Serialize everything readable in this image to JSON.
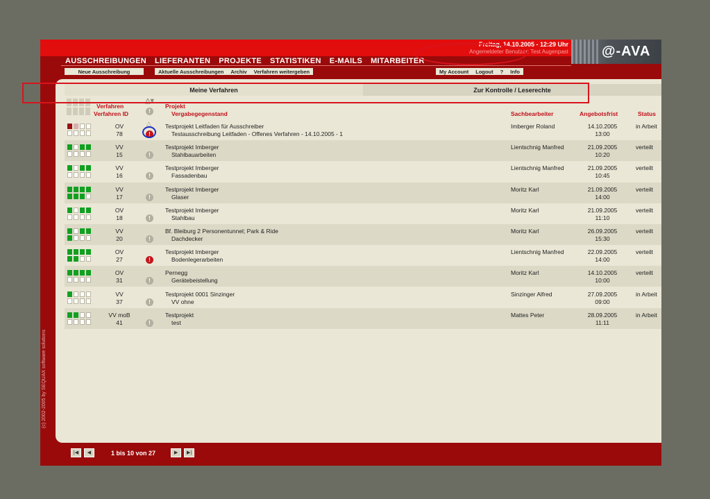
{
  "header": {
    "date": "Freitag, 14.10.2005 - 12:29 Uhr",
    "user": "Angemeldeter Benutzer:  Test Augenpast",
    "logo": "@-AVA"
  },
  "main_nav": [
    "AUSSCHREIBUNGEN",
    "LIEFERANTEN",
    "PROJEKTE",
    "STATISTIKEN",
    "E-MAILS",
    "MITARBEITER"
  ],
  "sub_nav_left": [
    "Neue Ausschreibung"
  ],
  "sub_nav_mid": [
    "Aktuelle Ausschreibungen",
    "Archiv",
    "Verfahren weitergeben"
  ],
  "sub_nav_right": [
    "My Account",
    "Logout",
    "?",
    "Info"
  ],
  "tabs": {
    "mine": "Meine Verfahren",
    "control": "Zur Kontrolle / Leserechte"
  },
  "columns": {
    "verfahren": "Verfahren",
    "verfahren_id": "Verfahren ID",
    "projekt": "Projekt",
    "vergabe": "Vergabegegenstand",
    "sachbearbeiter": "Sachbearbeiter",
    "angebotsfrist": "Angebotsfrist",
    "status": "Status"
  },
  "rows": [
    {
      "type": "OV",
      "id": "78",
      "project": "Testprojekt Leitfaden für Ausschreiber",
      "subject": "Testausschreibung Leitfaden - Offenes Verfahren - 14.10.2005 - 1",
      "person": "Imberger Roland",
      "date": "14.10.2005",
      "time": "13:00",
      "status": "in Arbeit",
      "squares": [
        "r",
        "p",
        "w",
        "w",
        "w",
        "w",
        "w",
        "w"
      ],
      "warn": "red"
    },
    {
      "type": "VV",
      "id": "15",
      "project": "Testprojekt Imberger",
      "subject": "Stahlbauarbeiten",
      "person": "Lientschnig Manfred",
      "date": "21.09.2005",
      "time": "10:20",
      "status": "verteilt",
      "squares": [
        "g",
        "w",
        "g",
        "g",
        "w",
        "w",
        "w",
        "w"
      ],
      "warn": "grey"
    },
    {
      "type": "VV",
      "id": "16",
      "project": "Testprojekt Imberger",
      "subject": "Fassadenbau",
      "person": "Lientschnig Manfred",
      "date": "21.09.2005",
      "time": "10:45",
      "status": "verteilt",
      "squares": [
        "g",
        "w",
        "g",
        "g",
        "w",
        "w",
        "w",
        "w"
      ],
      "warn": "grey"
    },
    {
      "type": "VV",
      "id": "17",
      "project": "Testprojekt Imberger",
      "subject": "Glaser",
      "person": "Moritz Karl",
      "date": "21.09.2005",
      "time": "14:00",
      "status": "verteilt",
      "squares": [
        "g",
        "g",
        "g",
        "g",
        "g",
        "g",
        "g",
        "w"
      ],
      "warn": "grey"
    },
    {
      "type": "OV",
      "id": "18",
      "project": "Testprojekt Imberger",
      "subject": "Stahlbau",
      "person": "Moritz Karl",
      "date": "21.09.2005",
      "time": "11:10",
      "status": "verteilt",
      "squares": [
        "g",
        "w",
        "g",
        "g",
        "w",
        "w",
        "w",
        "w"
      ],
      "warn": "grey"
    },
    {
      "type": "VV",
      "id": "20",
      "project": "Bf. Bleiburg 2 Personentunnel; Park & Ride",
      "subject": "Dachdecker",
      "person": "Moritz Karl",
      "date": "26.09.2005",
      "time": "15:30",
      "status": "verteilt",
      "squares": [
        "g",
        "w",
        "g",
        "g",
        "g",
        "w",
        "w",
        "w"
      ],
      "warn": "grey"
    },
    {
      "type": "OV",
      "id": "27",
      "project": "Testprojekt Imberger",
      "subject": "Bodenlegerarbeiten",
      "person": "Lientschnig Manfred",
      "date": "22.09.2005",
      "time": "14:00",
      "status": "verteilt",
      "squares": [
        "g",
        "g",
        "g",
        "g",
        "g",
        "g",
        "w",
        "w"
      ],
      "warn": "red"
    },
    {
      "type": "OV",
      "id": "31",
      "project": "Pernegg",
      "subject": "Gerätebeistellung",
      "person": "Moritz Karl",
      "date": "14.10.2005",
      "time": "10:00",
      "status": "verteilt",
      "squares": [
        "g",
        "g",
        "g",
        "g",
        "w",
        "w",
        "w",
        "w"
      ],
      "warn": "grey"
    },
    {
      "type": "VV",
      "id": "37",
      "project": "Testprojekt 0001 Sinzinger",
      "subject": "VV ohne",
      "person": "Sinzinger Alfred",
      "date": "27.09.2005",
      "time": "09:00",
      "status": "in Arbeit",
      "squares": [
        "g",
        "w",
        "w",
        "w",
        "w",
        "w",
        "w",
        "w"
      ],
      "warn": "grey"
    },
    {
      "type": "VV moB",
      "id": "41",
      "project": "Testprojekt",
      "subject": "test",
      "person": "Mattes Peter",
      "date": "28.09.2005",
      "time": "11:11",
      "status": "in Arbeit",
      "squares": [
        "g",
        "g",
        "w",
        "w",
        "w",
        "w",
        "w",
        "w"
      ],
      "warn": "grey"
    }
  ],
  "pager": {
    "text": "1 bis 10 von 27"
  },
  "copyright": "(c) 2002-2005 by SEQUAX software solutions"
}
